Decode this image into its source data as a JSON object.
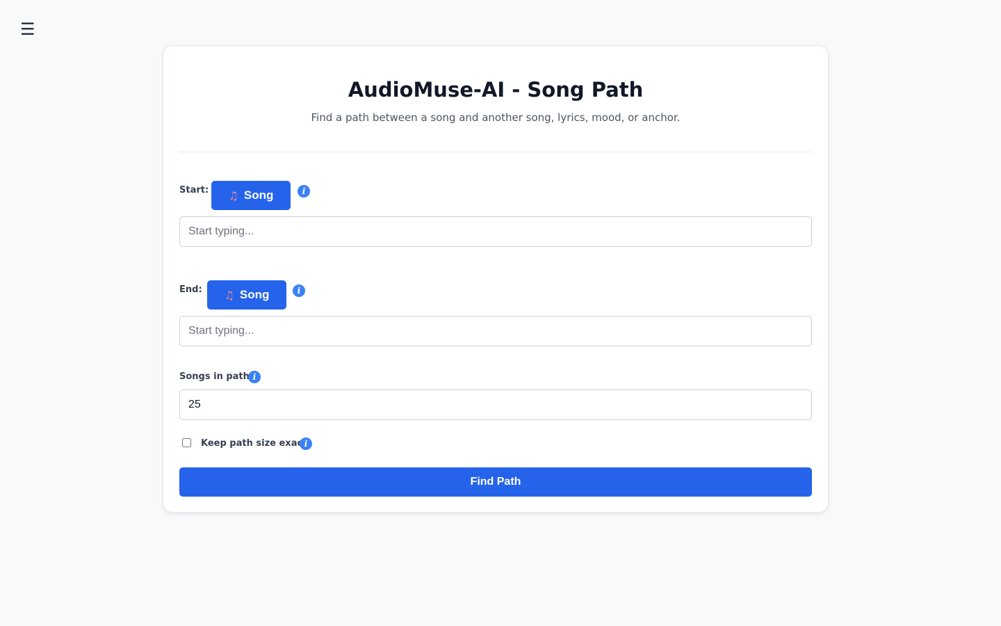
{
  "nav": {
    "menu_icon": "☰"
  },
  "page": {
    "title": "AudioMuse-AI - Song Path",
    "subtitle": "Find a path between a song and another song, lyrics, mood, or anchor."
  },
  "start": {
    "label": "Start:",
    "type_button": {
      "icon": "music-note-icon",
      "glyph": "♫",
      "label": "Song"
    },
    "info": "i",
    "input": {
      "value": "",
      "placeholder": "Start typing..."
    }
  },
  "end": {
    "label": "End:",
    "type_button": {
      "icon": "music-note-icon",
      "glyph": "♫",
      "label": "Song"
    },
    "info": "i",
    "input": {
      "value": "",
      "placeholder": "Start typing..."
    }
  },
  "songs_in_path": {
    "label": "Songs in path:",
    "info": "i",
    "value": "25"
  },
  "keep_exact": {
    "label": "Keep path size exact",
    "checked": false,
    "info": "i"
  },
  "actions": {
    "find_path_label": "Find Path"
  },
  "colors": {
    "primary": "#2563eb",
    "info": "#3b82f6",
    "background": "#f8f9fb"
  }
}
